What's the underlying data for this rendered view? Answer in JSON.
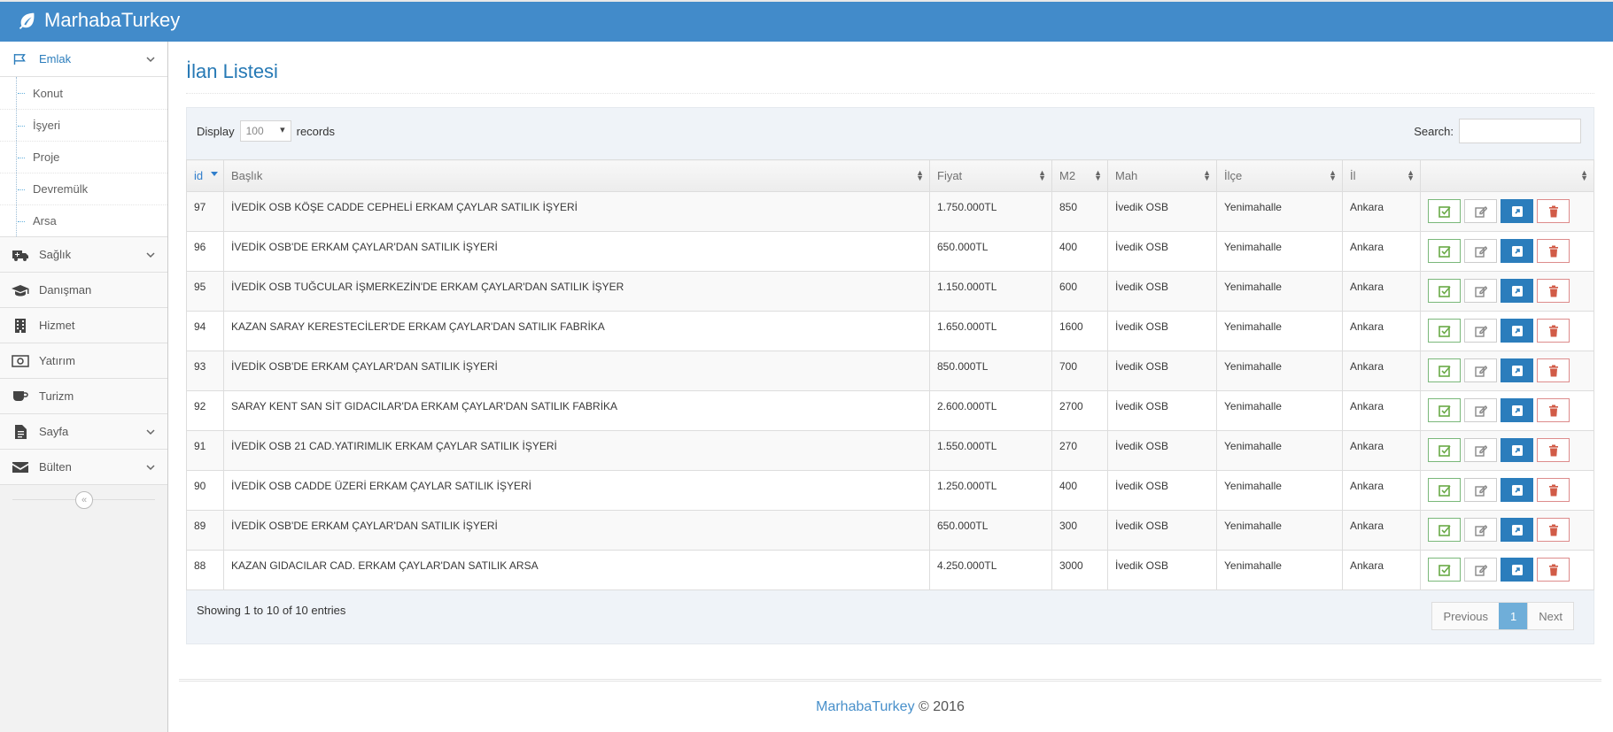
{
  "app": {
    "brand": "MarhabaTurkey"
  },
  "sidebar": {
    "items": [
      {
        "label": "Emlak",
        "icon": "flag-icon",
        "has_children": true,
        "active": true
      },
      {
        "label": "Sağlık",
        "icon": "ambulance-icon",
        "has_children": true
      },
      {
        "label": "Danışman",
        "icon": "graduation-cap-icon",
        "has_children": false
      },
      {
        "label": "Hizmet",
        "icon": "building-icon",
        "has_children": false
      },
      {
        "label": "Yatırım",
        "icon": "money-icon",
        "has_children": false
      },
      {
        "label": "Turizm",
        "icon": "coffee-icon",
        "has_children": false
      },
      {
        "label": "Sayfa",
        "icon": "file-icon",
        "has_children": true
      },
      {
        "label": "Bülten",
        "icon": "envelope-icon",
        "has_children": true
      }
    ],
    "submenu": [
      "Konut",
      "İşyeri",
      "Proje",
      "Devremülk",
      "Arsa"
    ],
    "collapse_label": "«"
  },
  "page": {
    "title": "İlan Listesi"
  },
  "table": {
    "display_label": "Display",
    "records_value": "100",
    "records_label": "records",
    "search_label": "Search:",
    "columns": [
      "id",
      "Başlık",
      "Fiyat",
      "M2",
      "Mah",
      "İlçe",
      "İl",
      ""
    ],
    "rows": [
      {
        "id": "97",
        "title": "İVEDİK OSB KÖŞE CADDE CEPHELİ ERKAM ÇAYLAR SATILIK İŞYERİ",
        "price": "1.750.000TL",
        "m2": "850",
        "mah": "İvedik OSB",
        "ilce": "Yenimahalle",
        "il": "Ankara"
      },
      {
        "id": "96",
        "title": "İVEDİK OSB'DE ERKAM ÇAYLAR'DAN SATILIK İŞYERİ",
        "price": "650.000TL",
        "m2": "400",
        "mah": "İvedik OSB",
        "ilce": "Yenimahalle",
        "il": "Ankara"
      },
      {
        "id": "95",
        "title": "İVEDİK OSB TUĞCULAR İŞMERKEZİN'DE ERKAM ÇAYLAR'DAN SATILIK İŞYER",
        "price": "1.150.000TL",
        "m2": "600",
        "mah": "İvedik OSB",
        "ilce": "Yenimahalle",
        "il": "Ankara"
      },
      {
        "id": "94",
        "title": "KAZAN SARAY KERESTECİLER'DE ERKAM ÇAYLAR'DAN SATILIK FABRİKA",
        "price": "1.650.000TL",
        "m2": "1600",
        "mah": "İvedik OSB",
        "ilce": "Yenimahalle",
        "il": "Ankara"
      },
      {
        "id": "93",
        "title": "İVEDİK OSB'DE ERKAM ÇAYLAR'DAN SATILIK İŞYERİ",
        "price": "850.000TL",
        "m2": "700",
        "mah": "İvedik OSB",
        "ilce": "Yenimahalle",
        "il": "Ankara"
      },
      {
        "id": "92",
        "title": "SARAY KENT SAN SİT GIDACILAR'DA ERKAM ÇAYLAR'DAN SATILIK FABRİKA",
        "price": "2.600.000TL",
        "m2": "2700",
        "mah": "İvedik OSB",
        "ilce": "Yenimahalle",
        "il": "Ankara"
      },
      {
        "id": "91",
        "title": "İVEDİK OSB 21 CAD.YATIRIMLIK ERKAM ÇAYLAR SATILIK İŞYERİ",
        "price": "1.550.000TL",
        "m2": "270",
        "mah": "İvedik OSB",
        "ilce": "Yenimahalle",
        "il": "Ankara"
      },
      {
        "id": "90",
        "title": "İVEDİK OSB CADDE ÜZERİ ERKAM ÇAYLAR SATILIK İŞYERİ",
        "price": "1.250.000TL",
        "m2": "400",
        "mah": "İvedik OSB",
        "ilce": "Yenimahalle",
        "il": "Ankara"
      },
      {
        "id": "89",
        "title": "İVEDİK OSB'DE ERKAM ÇAYLAR'DAN SATILIK İŞYERİ",
        "price": "650.000TL",
        "m2": "300",
        "mah": "İvedik OSB",
        "ilce": "Yenimahalle",
        "il": "Ankara"
      },
      {
        "id": "88",
        "title": "KAZAN GIDACILAR CAD. ERKAM ÇAYLAR'DAN SATILIK ARSA",
        "price": "4.250.000TL",
        "m2": "3000",
        "mah": "İvedik OSB",
        "ilce": "Yenimahalle",
        "il": "Ankara"
      }
    ],
    "info": "Showing 1 to 10 of 10 entries",
    "pager": {
      "prev": "Previous",
      "current": "1",
      "next": "Next"
    }
  },
  "footer": {
    "brand": "MarhabaTurkey",
    "copy": "© 2016"
  },
  "colors": {
    "navbar": "#428bca",
    "accent": "#2679b5",
    "success": "#69aa46",
    "danger": "#d15b47"
  }
}
